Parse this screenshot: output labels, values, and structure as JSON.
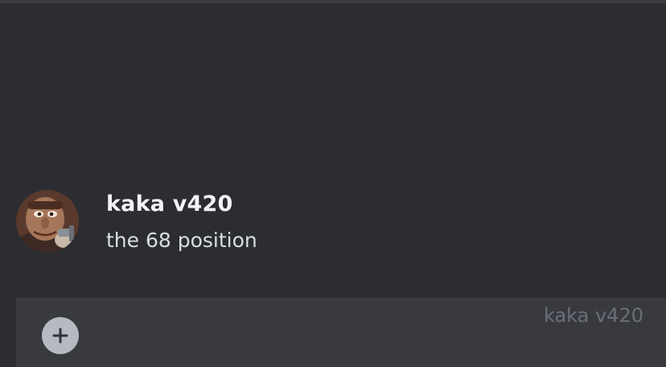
{
  "message": {
    "avatar_icon": "user-avatar-icon",
    "username": "kaka v420",
    "text": "the 68 position"
  },
  "composer": {
    "attach_icon": "plus-icon",
    "input_text": "kaka v420"
  },
  "colors": {
    "background": "#2b2d31",
    "composer": "#383a40",
    "username": "#f2f3f5",
    "message_text": "#dbdee1",
    "placeholder": "#6d6f78",
    "attach_button": "#b5bac1"
  }
}
